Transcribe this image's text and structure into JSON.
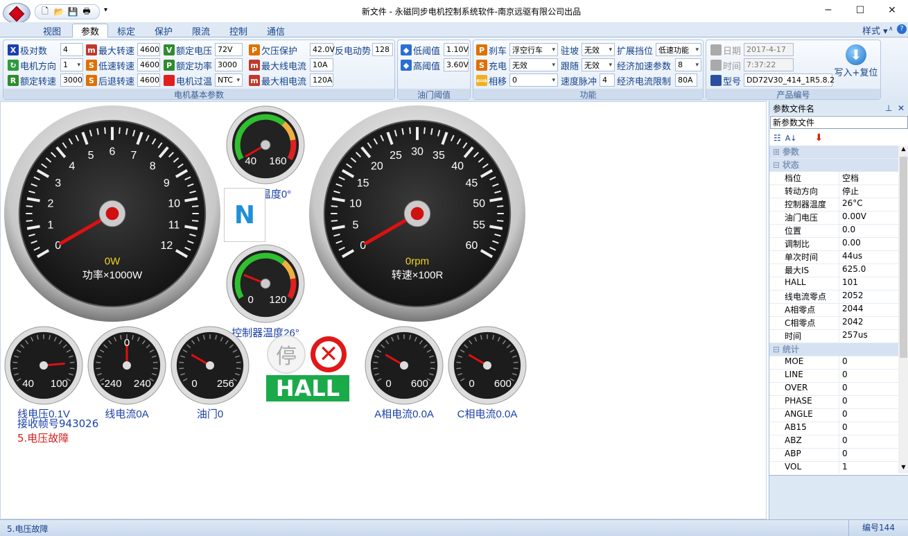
{
  "window": {
    "title": "新文件 - 永磁同步电机控制系统软件-南京远驱有限公司出品",
    "minimize": "─",
    "maximize": "☐",
    "close": "✕"
  },
  "qat": {
    "more": "▾"
  },
  "tabs": [
    "视图",
    "参数",
    "标定",
    "保护",
    "限流",
    "控制",
    "通信"
  ],
  "style_menu": "样式",
  "groups": {
    "motor": {
      "caption": "电机基本参数",
      "rows": [
        [
          {
            "label": "极对数",
            "icon": "X",
            "color": "#1b3fb0",
            "value": "4"
          },
          {
            "label": "最大转速",
            "icon": "m",
            "color": "#c0392b",
            "value": "4600"
          },
          {
            "label": "额定电压",
            "icon": "V",
            "color": "#2e8b2e",
            "value": "72V"
          }
        ],
        [
          {
            "label": "电机方向",
            "icon": "↻",
            "color": "#2e9b3e",
            "value": "1"
          },
          {
            "label": "低速转速",
            "icon": "S",
            "color": "#e07000",
            "value": "4600"
          },
          {
            "label": "额定功率",
            "icon": "P",
            "color": "#2e8b2e",
            "value": "3000"
          }
        ],
        [
          {
            "label": "额定转速",
            "icon": "R",
            "color": "#2e8b2e",
            "value": "3000"
          },
          {
            "label": "后退转速",
            "icon": "S",
            "color": "#e07000",
            "value": "4600"
          },
          {
            "label": "电机过温",
            "icon": "",
            "color": "#e02020",
            "value": "NTC"
          }
        ]
      ],
      "col4": [
        {
          "label": "欠压保护",
          "icon": "P",
          "color": "#e07000",
          "value": "42.0V",
          "extra_label": "反电动势",
          "extra_value": "128"
        },
        {
          "label": "最大线电流",
          "icon": "m",
          "color": "#c0392b",
          "value": "10A"
        },
        {
          "label": "最大相电流",
          "icon": "m",
          "color": "#c0392b",
          "value": "120A"
        }
      ]
    },
    "throttle": {
      "caption": "油门阈值",
      "rows": [
        {
          "label": "低阈值",
          "value": "1.10V"
        },
        {
          "label": "高阈值",
          "value": "3.60V"
        }
      ]
    },
    "function": {
      "caption": "功能",
      "col1": [
        {
          "label": "刹车",
          "icon": "P",
          "color": "#e07000",
          "value": "浮空行车"
        },
        {
          "label": "充电",
          "icon": "S",
          "color": "#e07000",
          "value": "无效"
        },
        {
          "label": "相移",
          "icon": "⟺",
          "color": "#f0b020",
          "value": "0"
        }
      ],
      "col2": [
        {
          "label": "驻坡",
          "value": "无效"
        },
        {
          "label": "跟随",
          "value": "无效"
        },
        {
          "label": "速度脉冲",
          "value": "4"
        }
      ],
      "col3": [
        {
          "label": "扩展挡位",
          "value": "低速功能"
        },
        {
          "label": "经济加速参数",
          "value": "8"
        },
        {
          "label": "经济电流限制",
          "value": "80A"
        }
      ]
    },
    "product": {
      "caption": "产品编号",
      "rows": [
        {
          "label": "日期",
          "value": "2017-4-17"
        },
        {
          "label": "时间",
          "value": "7:37:22"
        },
        {
          "label": "型号",
          "value": "DD72V30_414_1R5.8.2"
        }
      ],
      "write_button": "写入+复位"
    }
  },
  "gauges": {
    "power": {
      "value_text": "0W",
      "unit": "功率×1000W",
      "ticks": [
        "0",
        "1",
        "2",
        "3",
        "4",
        "5",
        "6",
        "7",
        "8",
        "9",
        "10",
        "11",
        "12"
      ],
      "value": 0
    },
    "speed": {
      "value_text": "0rpm",
      "unit": "转速×100R",
      "ticks": [
        "0",
        "5",
        "10",
        "15",
        "20",
        "25",
        "30",
        "35",
        "40",
        "45",
        "50",
        "55",
        "60"
      ],
      "value": 0
    },
    "motor_temp": {
      "label": "电机温度0°",
      "min": "40",
      "max": "160",
      "value": 0
    },
    "ctrl_temp": {
      "label": "控制器温度26°",
      "min": "0",
      "max": "120",
      "value": 26
    },
    "small": [
      {
        "label": "线电压0.1V",
        "min": "40",
        "max": "100",
        "mid": ""
      },
      {
        "label": "线电流0A",
        "min": "-240",
        "max": "240",
        "mid": "0"
      },
      {
        "label": "油门0",
        "min": "0",
        "max": "256",
        "mid": ""
      },
      {
        "label": "A相电流0.0A",
        "min": "0",
        "max": "600",
        "mid": ""
      },
      {
        "label": "C相电流0.0A",
        "min": "0",
        "max": "600",
        "mid": ""
      }
    ]
  },
  "gear": "N",
  "stop_text": "停",
  "error_symbol": "✕",
  "hall_text": "HALL",
  "frame_text": "接收帧号943026",
  "fault_text": "5.电压故障",
  "right_panel": {
    "header": "参数文件名",
    "pin": "⊥",
    "close": "✕",
    "file_name": "新参数文件",
    "categories": [
      {
        "name": "参数",
        "collapsed": true,
        "items": []
      },
      {
        "name": "状态",
        "collapsed": false,
        "items": [
          {
            "k": "档位",
            "v": "空档"
          },
          {
            "k": "转动方向",
            "v": "停止"
          },
          {
            "k": "控制器温度",
            "v": "26°C"
          },
          {
            "k": "油门电压",
            "v": "0.00V"
          },
          {
            "k": "位置",
            "v": "0.0"
          },
          {
            "k": "调制比",
            "v": "0.00"
          },
          {
            "k": "单次时间",
            "v": "44us"
          },
          {
            "k": "最大IS",
            "v": "625.0"
          },
          {
            "k": "HALL",
            "v": "101"
          },
          {
            "k": "线电流零点",
            "v": "2052"
          },
          {
            "k": "A相零点",
            "v": "2044"
          },
          {
            "k": "C相零点",
            "v": "2042"
          },
          {
            "k": "时间",
            "v": "257us"
          }
        ]
      },
      {
        "name": "统计",
        "collapsed": false,
        "items": [
          {
            "k": "MOE",
            "v": "0"
          },
          {
            "k": "LINE",
            "v": "0"
          },
          {
            "k": "OVER",
            "v": "0"
          },
          {
            "k": "PHASE",
            "v": "0"
          },
          {
            "k": "ANGLE",
            "v": "0"
          },
          {
            "k": "AB15",
            "v": "0"
          },
          {
            "k": "ABZ",
            "v": "0"
          },
          {
            "k": "ABP",
            "v": "0"
          },
          {
            "k": "VOL",
            "v": "1"
          }
        ]
      }
    ]
  },
  "status": {
    "left": "5.电压故障",
    "right": "编号144"
  }
}
